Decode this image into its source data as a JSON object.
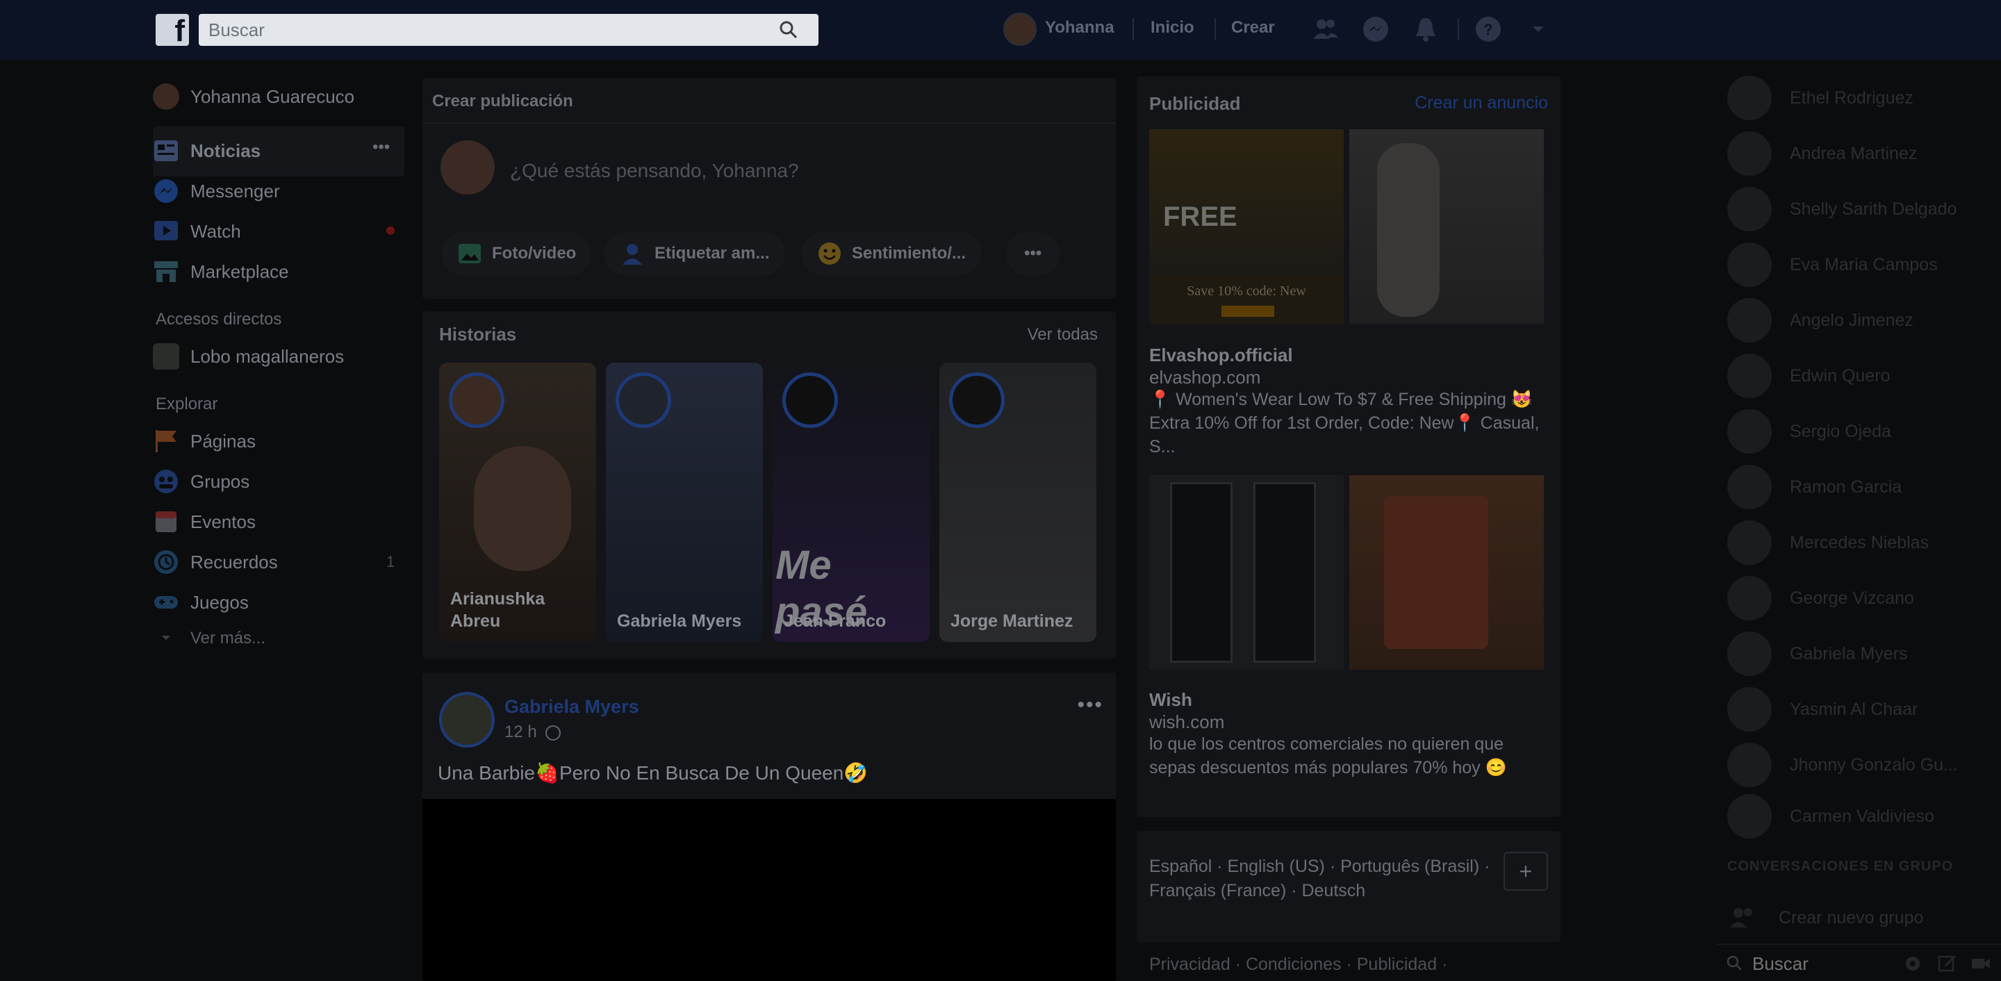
{
  "topbar": {
    "logo": "f",
    "search_placeholder": "Buscar",
    "user_name": "Yohanna",
    "home": "Inicio",
    "create": "Crear"
  },
  "left_nav": {
    "profile": "Yohanna Guarecuco",
    "items": [
      {
        "label": "Noticias",
        "color": "#3a4b6e"
      },
      {
        "label": "Messenger",
        "color": "#1b3b78"
      },
      {
        "label": "Watch",
        "color": "#1d3468"
      },
      {
        "label": "Marketplace",
        "color": "#2a4a55"
      }
    ],
    "more_dots": "•••",
    "shortcuts_title": "Accesos directos",
    "shortcuts": [
      {
        "label": "Lobo magallaneros"
      }
    ],
    "explore_title": "Explorar",
    "explore": [
      {
        "label": "Páginas",
        "color": "#6a3a1c"
      },
      {
        "label": "Grupos",
        "color": "#1d3468"
      },
      {
        "label": "Eventos",
        "color": "#6a2323"
      },
      {
        "label": "Recuerdos",
        "color": "#1d3c5c"
      },
      {
        "label": "Juegos",
        "color": "#1d3c5c"
      }
    ],
    "memories_count": "1",
    "see_more": "Ver más..."
  },
  "composer": {
    "title": "Crear publicación",
    "prompt": "¿Qué estás pensando, Yohanna?",
    "actions": [
      "Foto/video",
      "Etiquetar am...",
      "Sentimiento/..."
    ],
    "more": "•••"
  },
  "stories": {
    "title": "Historias",
    "see_all": "Ver todas",
    "items": [
      {
        "name": "Arianushka Abreu",
        "bg": "#2b241f"
      },
      {
        "name": "Gabriela Myers",
        "bg": "#1f232c"
      },
      {
        "name": "Jean Franco",
        "bg": "#1a1424",
        "overlay": "Me pasé"
      },
      {
        "name": "Jorge Martinez",
        "bg": "#1d1e20"
      }
    ]
  },
  "post": {
    "author": "Gabriela Myers",
    "time": "12 h",
    "text": "Una Barbie🍓Pero No En Busca De Un Queen🤣",
    "more": "•••"
  },
  "ads": {
    "title": "Publicidad",
    "create": "Crear un anuncio",
    "list": [
      {
        "name": "Elvashop.official",
        "url": "elvashop.com",
        "desc": "📍 Women's Wear Low To $7 & Free Shipping 😻 Extra 10% Off for 1st Order, Code: New📍 Casual, S...",
        "img1_text": "FREE",
        "img1_sub": "Save 10% code: New"
      },
      {
        "name": "Wish",
        "url": "wish.com",
        "desc": "lo que los centros comerciales no quieren que sepas descuentos más populares 70% hoy 😊"
      }
    ]
  },
  "languages": {
    "text": "Español · English (US) · Português (Brasil) · Français (France) · Deutsch",
    "add": "+"
  },
  "footer": "Privacidad · Condiciones · Publicidad ·",
  "chat": {
    "contacts": [
      "Ethel Rodriguez",
      "Andrea Martinez",
      "Shelly Sarith Delgado",
      "Eva Maria Campos",
      "Angelo Jimenez",
      "Edwin Quero",
      "Sergio Ojeda",
      "Ramon Garcia",
      "Mercedes Nieblas",
      "George Vizcano",
      "Gabriela Myers",
      "Yasmin Al Chaar",
      "Jhonny Gonzalo Gu...",
      "Carmen Valdivieso"
    ],
    "group_title": "CONVERSACIONES EN GRUPO",
    "new_group": "Crear nuevo grupo",
    "search_placeholder": "Buscar"
  }
}
